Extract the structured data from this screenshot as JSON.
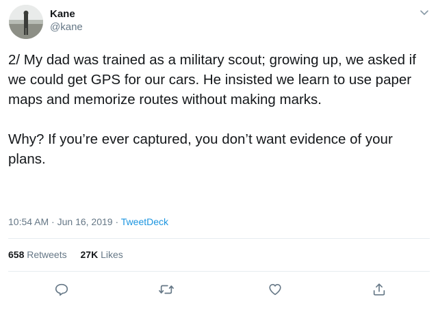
{
  "user": {
    "display_name": "Kane",
    "handle": "@kane"
  },
  "tweet": {
    "text": "2/ My dad was trained as a military scout; growing up, we asked if we could get GPS for our cars. He insisted we learn to use paper maps and memorize routes without making marks.\n\nWhy? If you’re ever captured, you don’t want evidence of your plans.",
    "time": "10:54 AM",
    "separator": " · ",
    "date": "Jun 16, 2019",
    "source": "TweetDeck"
  },
  "stats": {
    "retweets_count": "658",
    "retweets_label": " Retweets",
    "likes_count": "27K",
    "likes_label": " Likes"
  },
  "actions": [
    "reply-icon",
    "retweet-icon",
    "like-icon",
    "share-icon"
  ],
  "colors": {
    "text": "#14171a",
    "secondary": "#657786",
    "link": "#1b95e0",
    "divider": "#e6ecf0"
  }
}
